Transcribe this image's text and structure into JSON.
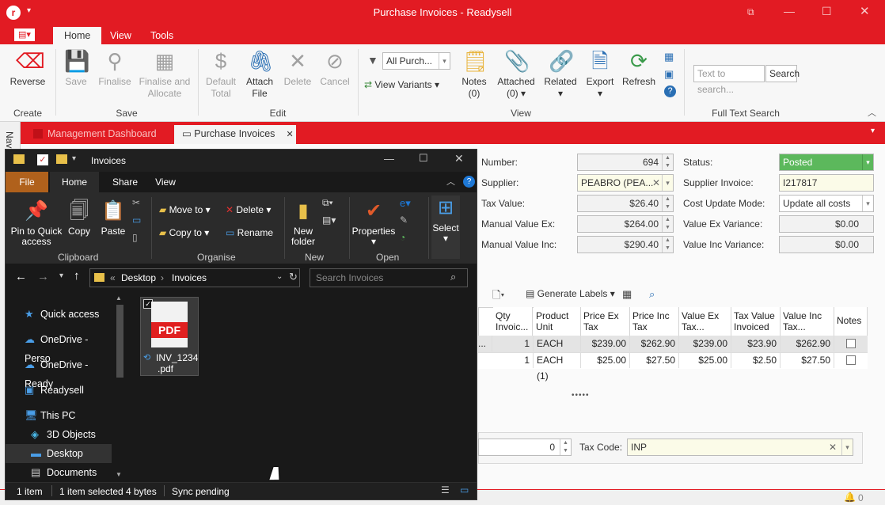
{
  "app": {
    "title": "Purchase Invoices - Readysell",
    "tabs": [
      "Home",
      "View",
      "Tools"
    ],
    "ribbon": {
      "create": {
        "group": "Create",
        "reverse": "Reverse"
      },
      "save": {
        "group": "Save",
        "save": "Save",
        "finalise": "Finalise",
        "finalise_allocate": [
          "Finalise and",
          "Allocate"
        ]
      },
      "edit": {
        "group": "Edit",
        "default_total": [
          "Default",
          "Total"
        ],
        "attach_file": [
          "Attach",
          "File"
        ],
        "delete": "Delete",
        "cancel": "Cancel"
      },
      "view": {
        "group": "View",
        "filter_value": "All Purch...",
        "view_variants": "View Variants",
        "notes": "Notes",
        "notes_count": "(0)",
        "attached": "Attached",
        "attached_count": "(0)",
        "related": "Related",
        "export": "Export",
        "refresh": "Refresh"
      },
      "search": {
        "group": "Full Text Search",
        "placeholder": "Text to search...",
        "button": "Search"
      }
    },
    "doc_tabs": {
      "dashboard": "Management Dashboard",
      "invoices": "Purchase Invoices"
    },
    "side_nav": "Nav",
    "form": {
      "number_label": "Number:",
      "number": "694",
      "supplier_label": "Supplier:",
      "supplier": "PEABRO (PEA...",
      "tax_value_label": "Tax Value:",
      "tax_value": "$26.40",
      "manual_ex_label": "Manual Value Ex:",
      "manual_ex": "$264.00",
      "manual_inc_label": "Manual Value Inc:",
      "manual_inc": "$290.40",
      "status_label": "Status:",
      "status": "Posted",
      "supplier_invoice_label": "Supplier Invoice:",
      "supplier_invoice": "I217817",
      "cost_mode_label": "Cost Update Mode:",
      "cost_mode": "Update all costs",
      "ex_var_label": "Value Ex Variance:",
      "ex_var": "$0.00",
      "inc_var_label": "Value Inc Variance:",
      "inc_var": "$0.00"
    },
    "lines_toolbar": {
      "generate_labels": "Generate Labels"
    },
    "table": {
      "headers": [
        [
          "Qty",
          "Invoic..."
        ],
        [
          "Product",
          "Unit"
        ],
        [
          "Price Ex",
          "Tax"
        ],
        [
          "Price Inc",
          "Tax"
        ],
        [
          "Value Ex",
          "Tax..."
        ],
        [
          "Tax Value",
          "Invoiced"
        ],
        [
          "Value Inc",
          "Tax..."
        ],
        [
          "Notes",
          ""
        ]
      ],
      "rows": [
        {
          "prefix": "...",
          "qty": "1",
          "unit": "EACH (1)",
          "price_ex": "$239.00",
          "price_inc": "$262.90",
          "value_ex": "$239.00",
          "tax_value": "$23.90",
          "value_inc": "$262.90"
        },
        {
          "prefix": "",
          "qty": "1",
          "unit": "EACH (1)",
          "price_ex": "$25.00",
          "price_inc": "$27.50",
          "value_ex": "$25.00",
          "tax_value": "$2.50",
          "value_inc": "$27.50"
        }
      ]
    },
    "bottom": {
      "amount": "0",
      "tax_code_label": "Tax Code:",
      "tax_code": "INP"
    },
    "status_count": "0"
  },
  "explorer": {
    "title": "Invoices",
    "tabs": {
      "file": "File",
      "home": "Home",
      "share": "Share",
      "view": "View"
    },
    "ribbon": {
      "pin": [
        "Pin to Quick",
        "access"
      ],
      "copy": "Copy",
      "paste": "Paste",
      "clipboard": "Clipboard",
      "move_to": "Move to",
      "copy_to": "Copy to",
      "delete": "Delete",
      "rename": "Rename",
      "organise": "Organise",
      "new_folder": [
        "New",
        "folder"
      ],
      "new": "New",
      "properties": "Properties",
      "open": "Open",
      "select": "Select"
    },
    "breadcrumb": {
      "sep": "«",
      "desktop": "Desktop",
      "invoices": "Invoices"
    },
    "search_placeholder": "Search Invoices",
    "nav": [
      "Quick access",
      "OneDrive - Perso",
      "OneDrive - Ready",
      "Readysell",
      "This PC",
      "3D Objects",
      "Desktop",
      "Documents"
    ],
    "file": {
      "name1": "INV_1234",
      ".ext": ".pdf",
      "ext": ".pdf",
      "badge": "PDF"
    },
    "status": {
      "items": "1 item",
      "selected": "1 item selected",
      "size": "4 bytes",
      "sync": "Sync pending"
    }
  }
}
